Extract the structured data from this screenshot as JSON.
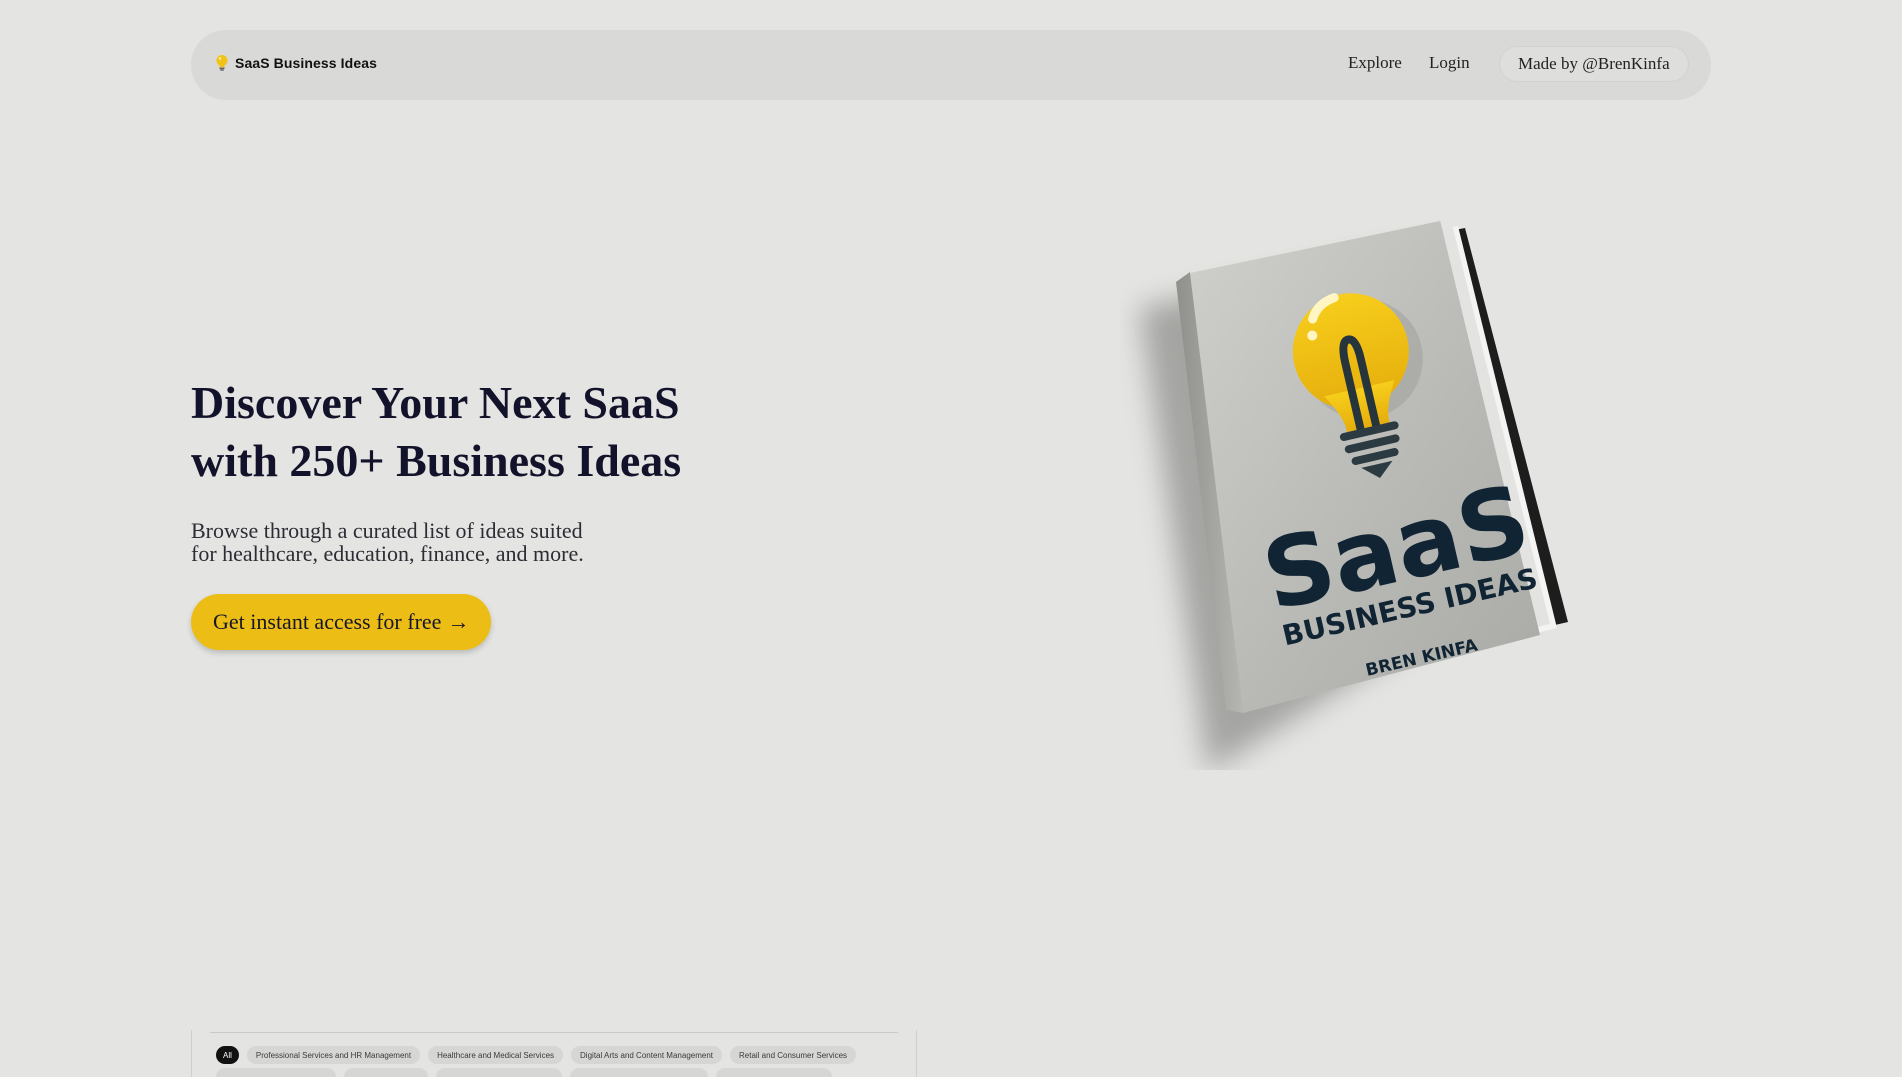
{
  "nav": {
    "brand": "SaaS Business Ideas",
    "brand_icon": "lightbulb-icon",
    "links": [
      {
        "label": "Explore"
      },
      {
        "label": "Login"
      }
    ],
    "made_by": "Made by @BrenKinfa"
  },
  "hero": {
    "title_lines": [
      "Discover Your Next SaaS",
      "with 250+ Business Ideas"
    ],
    "subtitle_lines": [
      "Browse through a curated list of ideas suited",
      "for healthcare, education, finance, and more."
    ],
    "cta_label": "Get instant access for free",
    "cta_arrow": "→"
  },
  "book": {
    "title": "SaaS",
    "subtitle": "BUSINESS IDEAS",
    "author": "BREN KINFA",
    "icon": "lightbulb-icon"
  },
  "preview": {
    "categories_row1": [
      "All",
      "Professional Services and HR Management",
      "Healthcare and Medical Services",
      "Digital Arts and Content Management",
      "Retail and Consumer Services"
    ],
    "active_category": "All"
  },
  "colors": {
    "background": "#e4e4e2",
    "navbar": "#d9d9d7",
    "accent": "#ecbd14",
    "text_dark": "#12122a",
    "book_title": "#102433"
  }
}
